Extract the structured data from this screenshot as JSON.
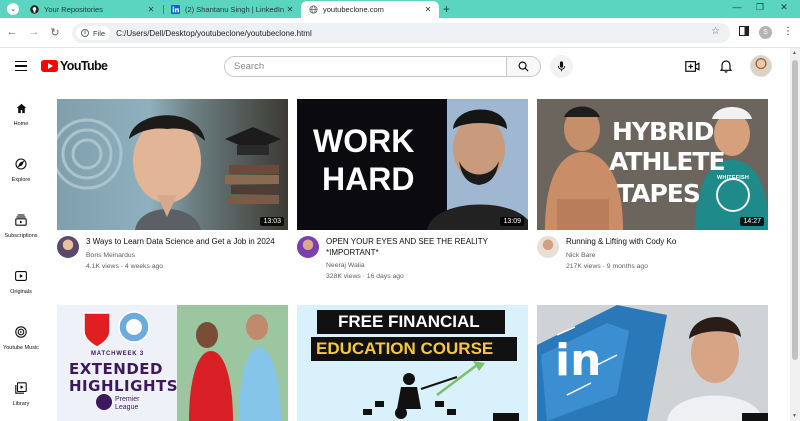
{
  "browser": {
    "tabs": [
      {
        "title": "Your Repositories",
        "icon": "github-icon",
        "active": false
      },
      {
        "title": "(2) Shantanu Singh | LinkedIn",
        "icon": "linkedin-icon",
        "active": false
      },
      {
        "title": "youtubeclone.com",
        "icon": "globe-icon",
        "active": true
      }
    ],
    "address": {
      "chip_label": "File",
      "url": "C:/Users/Dell/Desktop/youtubeclone/youtubeclone.html"
    },
    "profile_initial": "S"
  },
  "header": {
    "logo_text": "YouTube",
    "search_placeholder": "Search",
    "colors": {
      "brand_red": "#ff0000",
      "tab_strip": "#5bd4c0"
    }
  },
  "sidebar": {
    "items": [
      {
        "label": "Home",
        "icon": "home-icon"
      },
      {
        "label": "Explore",
        "icon": "explore-icon"
      },
      {
        "label": "Subscriptions",
        "icon": "subscriptions-icon"
      },
      {
        "label": "Originals",
        "icon": "originals-icon"
      },
      {
        "label": "Youtube Music",
        "icon": "music-icon"
      },
      {
        "label": "Library",
        "icon": "library-icon"
      }
    ]
  },
  "videos": [
    {
      "title": "3 Ways to Learn Data Science and Get a Job in 2024",
      "channel": "Boris Meinardus",
      "stats": "4.1K views · 4 weeks ago",
      "duration": "13:03"
    },
    {
      "title": "OPEN YOUR EYES AND SEE THE REALITY *IMPORTANT*",
      "channel": "Neeraj Walia",
      "stats": "328K views · 16 days ago",
      "duration": "13:09",
      "thumb_text": [
        "WORK",
        "HARD"
      ]
    },
    {
      "title": "Running & Lifting with Cody Ko",
      "channel": "Nick Bare",
      "stats": "217K views · 9 months ago",
      "duration": "14:27",
      "thumb_text": [
        "HYBRID",
        "ATHLETE",
        "TAPES"
      ],
      "shirt_text": "WHITEFISH"
    },
    {
      "thumb_text": [
        "EXTENDED",
        "HIGHLIGHTS"
      ],
      "thumb_caption": "MATCHWEEK 3",
      "thumb_logo": "Premier League"
    },
    {
      "thumb_text": [
        "FREE FINANCIAL",
        "EDUCATION COURSE"
      ]
    },
    {
      "thumb_text": [
        "in"
      ]
    }
  ]
}
